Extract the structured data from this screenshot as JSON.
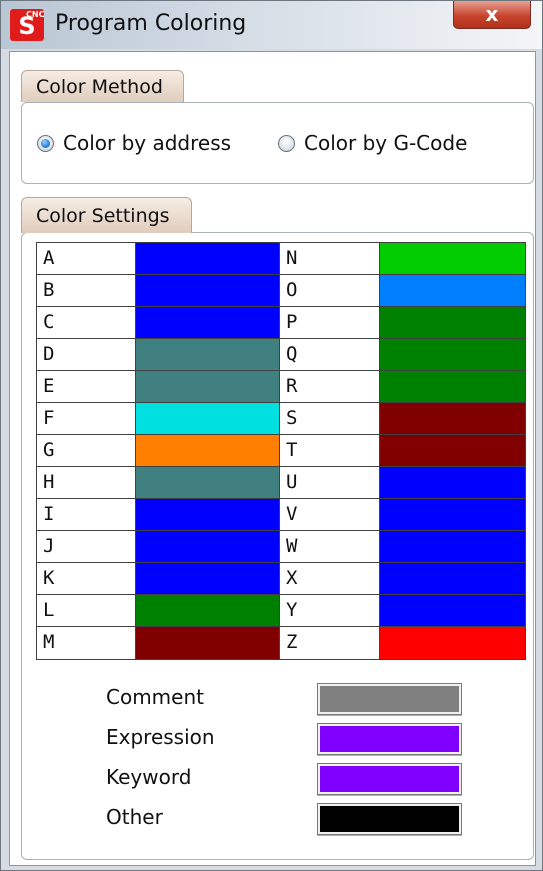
{
  "window": {
    "title": "Program Coloring",
    "close_glyph": "x",
    "app_icon": "cnc-s-logo"
  },
  "color_method": {
    "tab_label": "Color Method",
    "options": [
      {
        "label": "Color by address",
        "checked": true
      },
      {
        "label": "Color by G-Code",
        "checked": false
      }
    ]
  },
  "color_settings": {
    "tab_label": "Color Settings",
    "left_column": [
      {
        "letter": "A",
        "color": "#0000ff"
      },
      {
        "letter": "B",
        "color": "#0000ff"
      },
      {
        "letter": "C",
        "color": "#0000ff"
      },
      {
        "letter": "D",
        "color": "#408080"
      },
      {
        "letter": "E",
        "color": "#408080"
      },
      {
        "letter": "F",
        "color": "#00e0e0"
      },
      {
        "letter": "G",
        "color": "#ff8000"
      },
      {
        "letter": "H",
        "color": "#408080"
      },
      {
        "letter": "I",
        "color": "#0000ff"
      },
      {
        "letter": "J",
        "color": "#0000ff"
      },
      {
        "letter": "K",
        "color": "#0000ff"
      },
      {
        "letter": "L",
        "color": "#008000"
      },
      {
        "letter": "M",
        "color": "#800000"
      }
    ],
    "right_column": [
      {
        "letter": "N",
        "color": "#00cc00"
      },
      {
        "letter": "O",
        "color": "#0080ff"
      },
      {
        "letter": "P",
        "color": "#008000"
      },
      {
        "letter": "Q",
        "color": "#008000"
      },
      {
        "letter": "R",
        "color": "#008000"
      },
      {
        "letter": "S",
        "color": "#800000"
      },
      {
        "letter": "T",
        "color": "#800000"
      },
      {
        "letter": "U",
        "color": "#0000ff"
      },
      {
        "letter": "V",
        "color": "#0000ff"
      },
      {
        "letter": "W",
        "color": "#0000ff"
      },
      {
        "letter": "X",
        "color": "#0000ff"
      },
      {
        "letter": "Y",
        "color": "#0000ff"
      },
      {
        "letter": "Z",
        "color": "#ff0000"
      }
    ],
    "extras": [
      {
        "label": "Comment",
        "color": "#808080"
      },
      {
        "label": "Expression",
        "color": "#8000ff"
      },
      {
        "label": "Keyword",
        "color": "#8000ff"
      },
      {
        "label": "Other",
        "color": "#000000"
      }
    ]
  }
}
